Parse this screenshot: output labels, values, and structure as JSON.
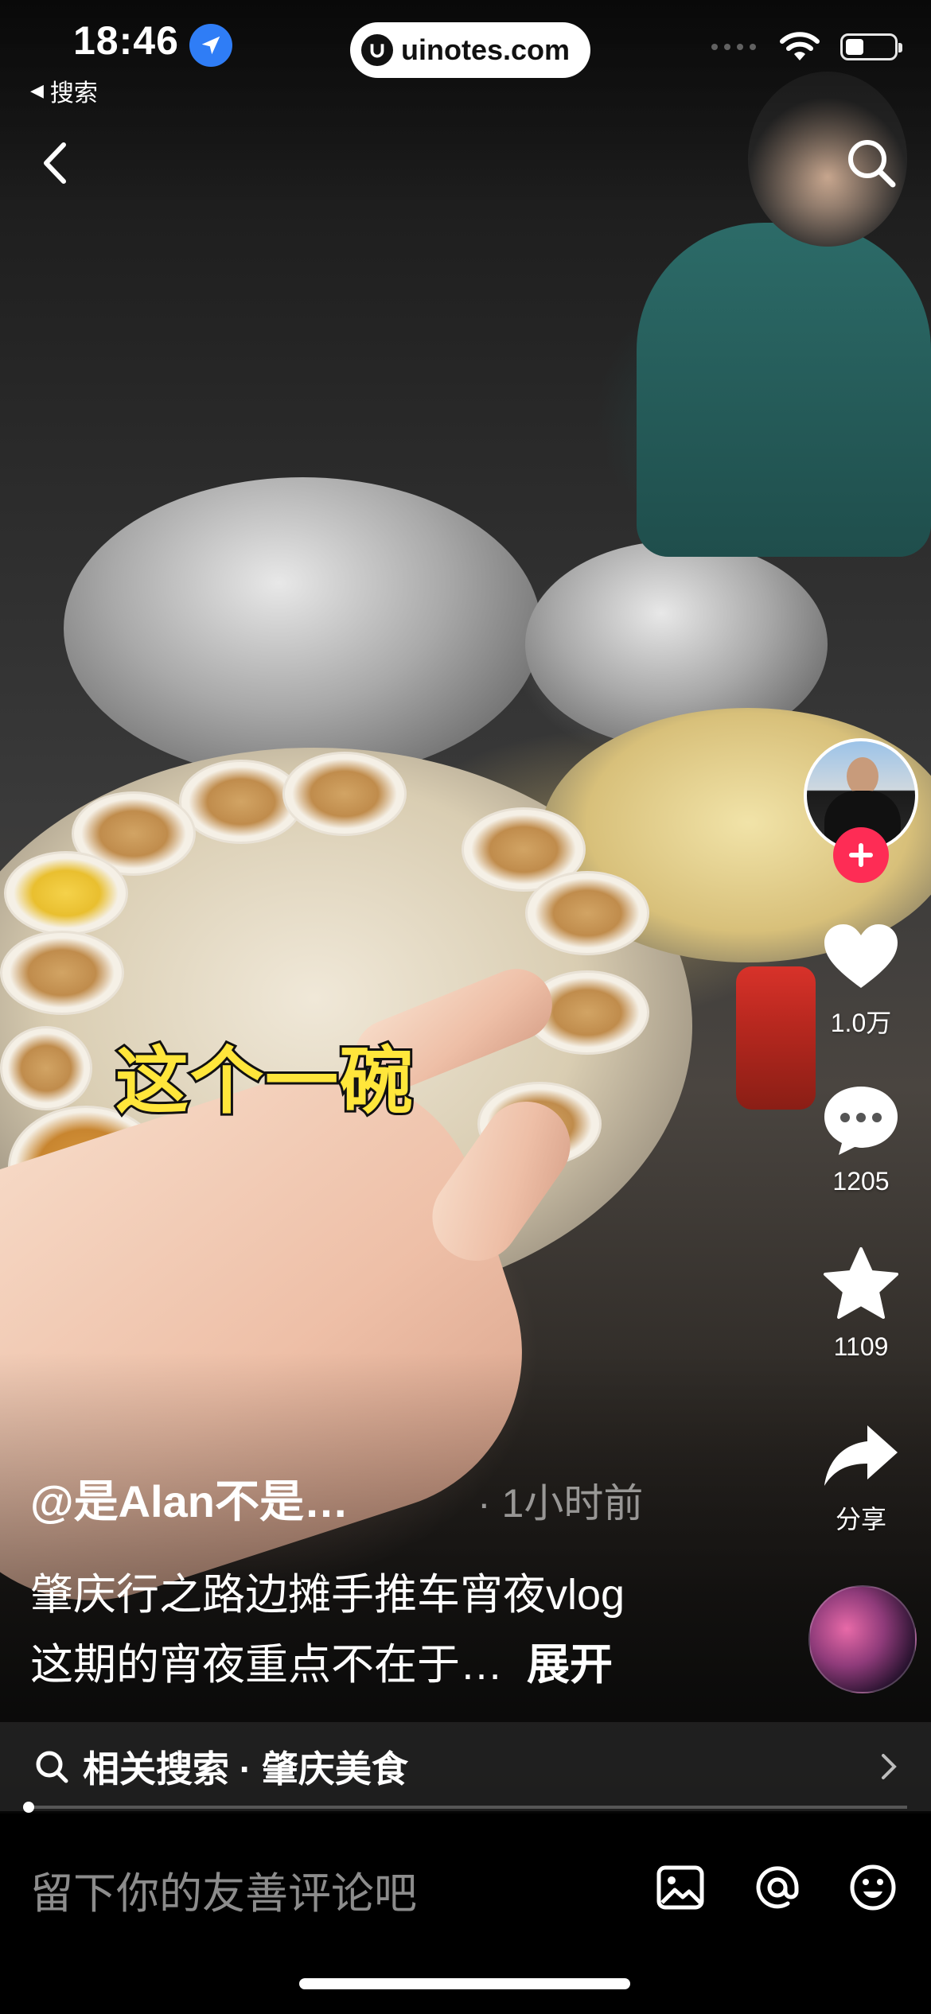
{
  "status_bar": {
    "time": "18:46",
    "back_app_label": "搜索"
  },
  "watermark": {
    "text": "uinotes.com"
  },
  "video": {
    "overlay_caption": "这个一碗"
  },
  "rail": {
    "likes": "1.0万",
    "comments": "1205",
    "favorites": "1109",
    "share_label": "分享"
  },
  "info": {
    "author": "@是Alan不是…",
    "time_ago": "· 1小时前",
    "desc_line1": "肇庆行之路边摊手推车宵夜vlog",
    "desc_line2": "这期的宵夜重点不在于…",
    "expand_label": "展开"
  },
  "related_search": {
    "label": "相关搜索 · 肇庆美食"
  },
  "playback": {
    "progress": 0.005
  },
  "comment_bar": {
    "placeholder": "留下你的友善评论吧"
  },
  "colors": {
    "accent_red": "#fe2c55",
    "location_blue": "#2f7df6",
    "caption_yellow": "#ffe63b"
  },
  "icons": {
    "back": "chevron-left-icon",
    "search": "search-icon",
    "like": "heart-icon",
    "comment": "comment-bubble-icon",
    "favorite": "star-icon",
    "share": "share-arrow-icon",
    "image": "image-icon",
    "mention": "at-icon",
    "emoji": "emoji-icon"
  }
}
